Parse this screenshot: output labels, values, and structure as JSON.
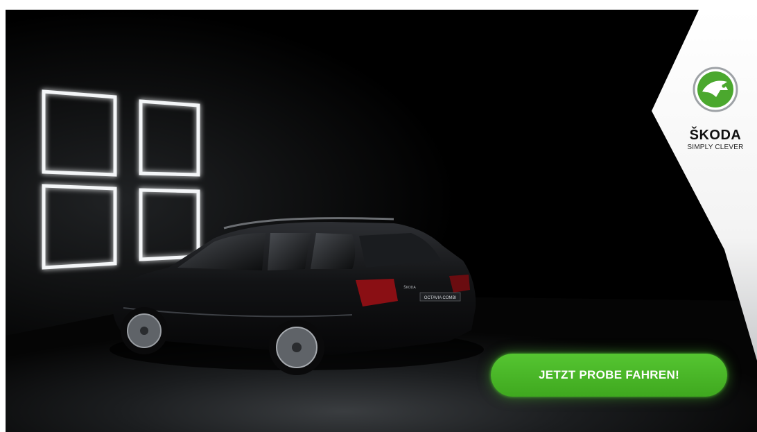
{
  "brand": {
    "name": "ŠKODA",
    "slogan": "SIMPLY CLEVER",
    "logo_icon": "skoda-winged-arrow-icon",
    "logo_color": "#4ba82e"
  },
  "cta": {
    "label": "JETZT PROBE FAHREN!",
    "color": "#4ba82e"
  },
  "car": {
    "badge": "OCTAVIA COMBI",
    "brand_badge": "ŠKODA"
  }
}
